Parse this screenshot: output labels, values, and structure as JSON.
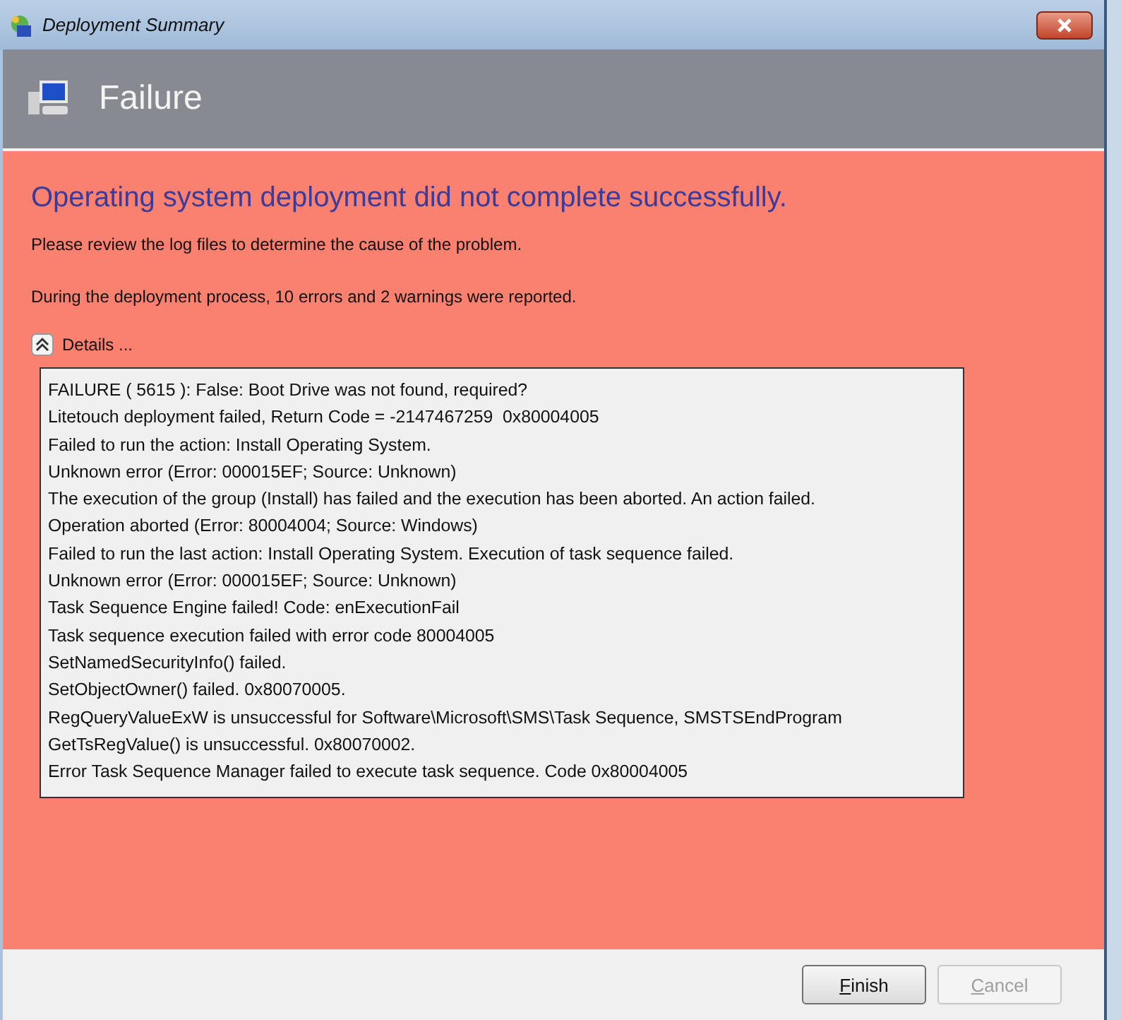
{
  "window": {
    "title": "Deployment Summary"
  },
  "header": {
    "title": "Failure"
  },
  "message": {
    "heading": "Operating system deployment did not complete successfully.",
    "lines": [
      "Please review the log files to determine the cause of the problem.",
      "During the deployment process, 10 errors and 2 warnings were reported."
    ]
  },
  "details": {
    "label": "Details ...",
    "expanded": true,
    "log": [
      "FAILURE ( 5615 ): False: Boot Drive was not found, required?",
      "Litetouch deployment failed, Return Code = -2147467259  0x80004005",
      "Failed to run the action: Install Operating System.",
      "Unknown error (Error: 000015EF; Source: Unknown)",
      "The execution of the group (Install) has failed and the execution has been aborted. An action failed.",
      "Operation aborted (Error: 80004004; Source: Windows)",
      "Failed to run the last action: Install Operating System. Execution of task sequence failed.",
      "Unknown error (Error: 000015EF; Source: Unknown)",
      "Task Sequence Engine failed! Code: enExecutionFail",
      "Task sequence execution failed with error code 80004005",
      "SetNamedSecurityInfo() failed.",
      "SetObjectOwner() failed. 0x80070005.",
      "RegQueryValueExW is unsuccessful for Software\\Microsoft\\SMS\\Task Sequence, SMSTSEndProgram",
      "GetTsRegValue() is unsuccessful. 0x80070002.",
      "Error Task Sequence Manager failed to execute task sequence. Code 0x80004005"
    ]
  },
  "buttons": [
    {
      "label": "Finish",
      "disabled": false
    },
    {
      "label": "Cancel",
      "disabled": true
    }
  ]
}
